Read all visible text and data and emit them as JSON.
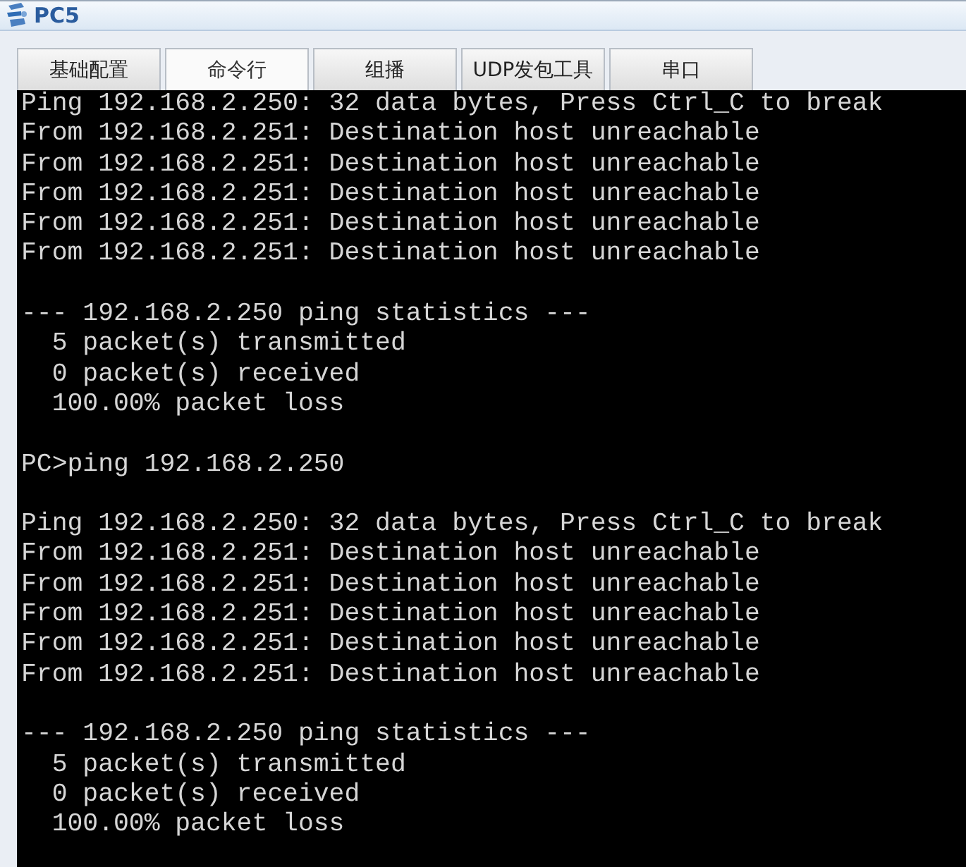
{
  "window": {
    "title": "PC5"
  },
  "tabs": [
    {
      "label": "基础配置",
      "selected": false
    },
    {
      "label": "命令行",
      "selected": true
    },
    {
      "label": "组播",
      "selected": false
    },
    {
      "label": "UDP发包工具",
      "selected": false
    },
    {
      "label": "串口",
      "selected": false
    }
  ],
  "console": {
    "blocks": [
      [
        "Ping 192.168.2.250: 32 data bytes, Press Ctrl_C to break",
        "From 192.168.2.251: Destination host unreachable",
        "From 192.168.2.251: Destination host unreachable",
        "From 192.168.2.251: Destination host unreachable",
        "From 192.168.2.251: Destination host unreachable",
        "From 192.168.2.251: Destination host unreachable"
      ],
      [
        "--- 192.168.2.250 ping statistics ---",
        "  5 packet(s) transmitted",
        "  0 packet(s) received",
        "  100.00% packet loss"
      ],
      [
        "PC>ping 192.168.2.250"
      ],
      [
        "Ping 192.168.2.250: 32 data bytes, Press Ctrl_C to break",
        "From 192.168.2.251: Destination host unreachable",
        "From 192.168.2.251: Destination host unreachable",
        "From 192.168.2.251: Destination host unreachable",
        "From 192.168.2.251: Destination host unreachable",
        "From 192.168.2.251: Destination host unreachable"
      ],
      [
        "--- 192.168.2.250 ping statistics ---",
        "  5 packet(s) transmitted",
        "  0 packet(s) received",
        "  100.00% packet loss"
      ]
    ]
  }
}
